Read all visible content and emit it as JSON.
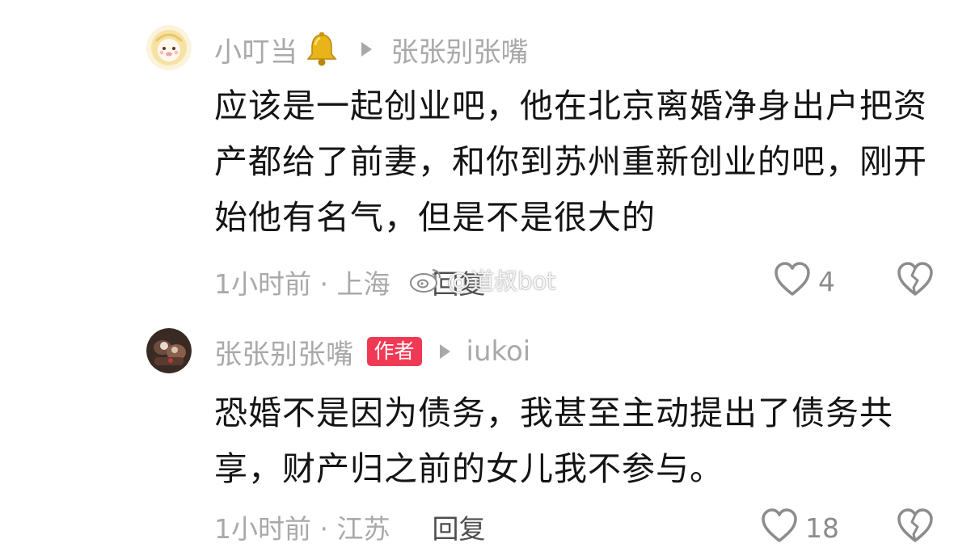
{
  "comments": [
    {
      "username": "小叮当",
      "reply_to": "张张别张嘴",
      "text": "应该是一起创业吧，他在北京离婚净身出户把资产都给了前妻，和你到苏州重新创业的吧，刚开始他有名气，但是不是很大的",
      "time_location": "1小时前 · 上海",
      "reply_label": "回复",
      "likes": "4"
    },
    {
      "username": "张张别张嘴",
      "badge": "作者",
      "reply_to": "iukoi",
      "text": "恐婚不是因为债务，我甚至主动提出了债务共享，财产归之前的女儿我不参与。",
      "time_location": "1小时前 · 江苏",
      "reply_label": "回复",
      "likes": "18"
    }
  ],
  "watermark": "@道叔bot",
  "colors": {
    "meta_gray": "#a9a9a9",
    "badge_red": "#f03a55",
    "body_text": "#141414"
  },
  "icons": {
    "bell": "bell-icon",
    "like": "heart-outline-icon",
    "dislike": "broken-heart-icon",
    "reply_arrow": "triangle-right-icon"
  }
}
